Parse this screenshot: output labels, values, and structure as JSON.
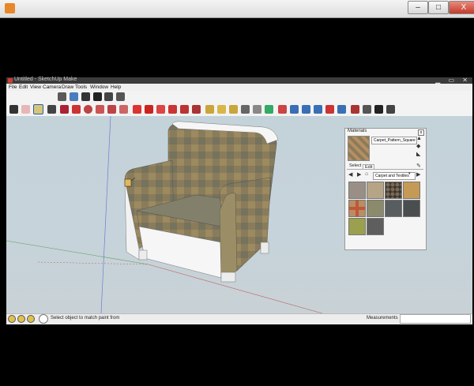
{
  "outer_window": {
    "minimize": "–",
    "maximize": "□",
    "close": "X"
  },
  "app": {
    "title": "Untitled - SketchUp Make",
    "menu": [
      "File",
      "Edit",
      "View",
      "Camera",
      "Draw",
      "Tools",
      "Window",
      "Help"
    ]
  },
  "toolbar_icons": [
    "get-started",
    "large-tool-set",
    "warehouse",
    "share",
    "extension",
    "select",
    "eraser",
    "paint-bucket",
    "rectangle",
    "line",
    "circle",
    "arc",
    "polygon",
    "freehand",
    "move",
    "rotate",
    "scale",
    "push-pull",
    "offset",
    "follow-me",
    "tape-measure",
    "protractor",
    "text",
    "dimension",
    "axes",
    "orbit",
    "pan",
    "zoom",
    "zoom-extents",
    "previous",
    "walk",
    "look-around",
    "section",
    "position-camera",
    "footprint"
  ],
  "status": {
    "text": "Select object to match paint from",
    "measurements_label": "Measurements"
  },
  "materials_panel": {
    "title": "Materials",
    "close": "x",
    "current_material": "Carpet_Pattern_Square",
    "tabs": [
      "Select",
      "Edit"
    ],
    "library": "Carpet and Textiles",
    "swatches": [
      {
        "name": "carpet-gray-loop",
        "color": "#9a8f86"
      },
      {
        "name": "carpet-beige",
        "color": "#b5a486"
      },
      {
        "name": "carpet-dark-pattern",
        "color": "#3a342e"
      },
      {
        "name": "carpet-tan",
        "color": "#c49a55"
      },
      {
        "name": "carpet-pattern-square",
        "color": "#b88e62"
      },
      {
        "name": "carpet-olive",
        "color": "#8c8a6c"
      },
      {
        "name": "carpet-slate",
        "color": "#585d60"
      },
      {
        "name": "carpet-charcoal",
        "color": "#4a4e4f"
      },
      {
        "name": "carpet-green-moss",
        "color": "#9aa04e"
      },
      {
        "name": "carpet-dark-gray",
        "color": "#5e5e5e"
      }
    ]
  },
  "colors": {
    "viewport_sky": "#c6d3da",
    "armchair_fabric": "#8a7c5a",
    "armchair_white": "#f6f6f6",
    "outer_frame": "#000000"
  }
}
